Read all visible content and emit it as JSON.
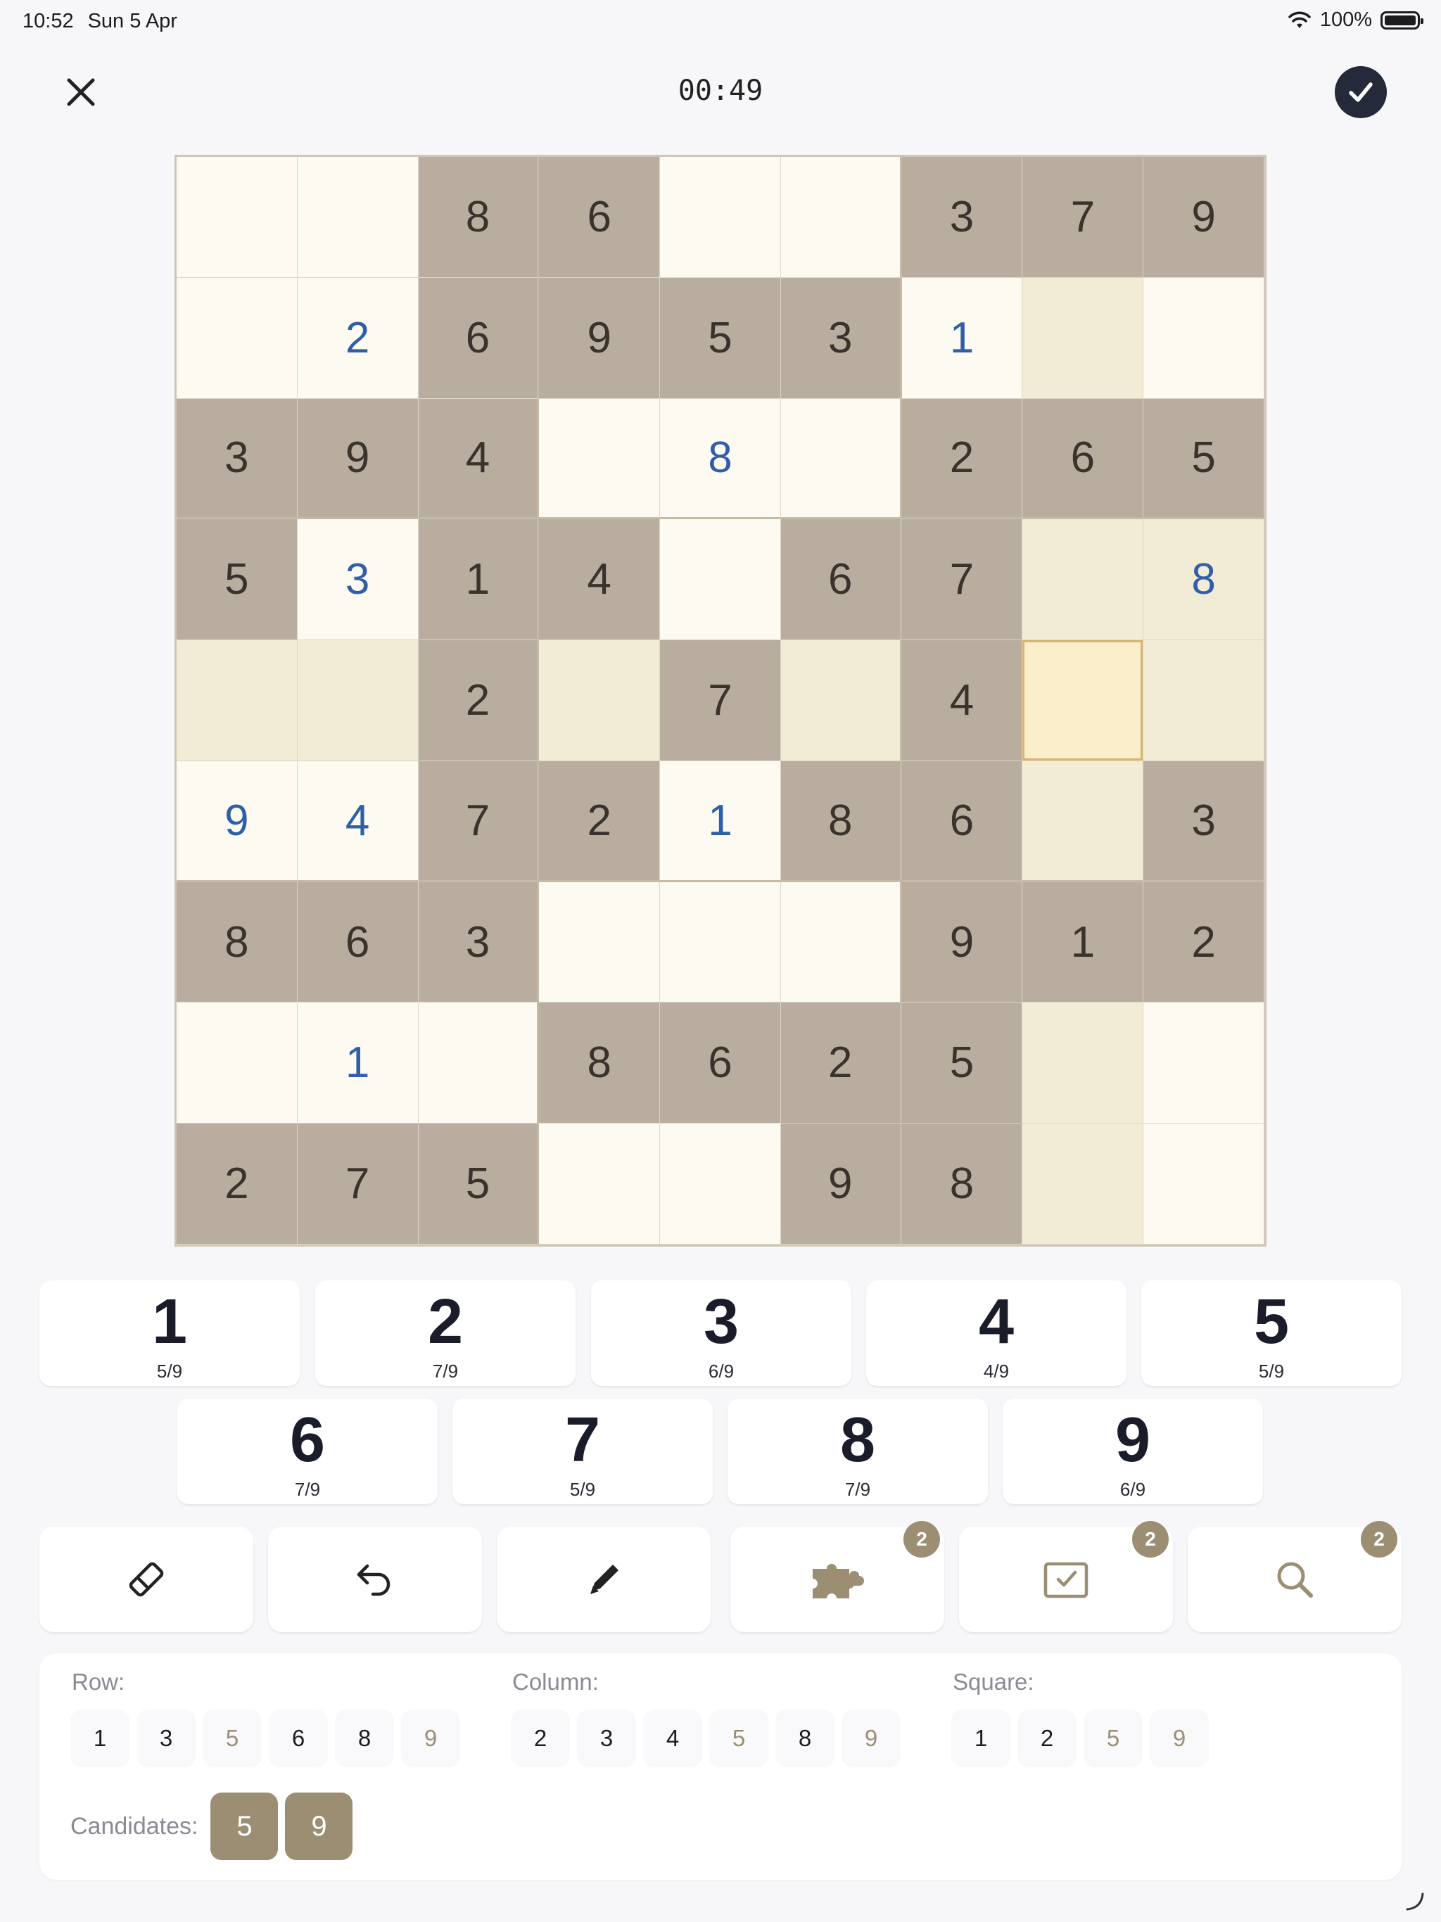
{
  "status": {
    "time": "10:52",
    "date": "Sun 5 Apr",
    "battery": "100%"
  },
  "header": {
    "timer": "00:49"
  },
  "board": {
    "selected": [
      4,
      7
    ],
    "cells": [
      [
        {
          "v": "",
          "t": "e"
        },
        {
          "v": "",
          "t": "e"
        },
        {
          "v": "8",
          "t": "g"
        },
        {
          "v": "6",
          "t": "g"
        },
        {
          "v": "",
          "t": "e"
        },
        {
          "v": "",
          "t": "e"
        },
        {
          "v": "3",
          "t": "g"
        },
        {
          "v": "7",
          "t": "g"
        },
        {
          "v": "9",
          "t": "g"
        }
      ],
      [
        {
          "v": "",
          "t": "e"
        },
        {
          "v": "2",
          "t": "u"
        },
        {
          "v": "6",
          "t": "g"
        },
        {
          "v": "9",
          "t": "g"
        },
        {
          "v": "5",
          "t": "g"
        },
        {
          "v": "3",
          "t": "g"
        },
        {
          "v": "1",
          "t": "u"
        },
        {
          "v": "",
          "t": "e"
        },
        {
          "v": "",
          "t": "e"
        }
      ],
      [
        {
          "v": "3",
          "t": "g"
        },
        {
          "v": "9",
          "t": "g"
        },
        {
          "v": "4",
          "t": "g"
        },
        {
          "v": "",
          "t": "e"
        },
        {
          "v": "8",
          "t": "u"
        },
        {
          "v": "",
          "t": "e"
        },
        {
          "v": "2",
          "t": "g"
        },
        {
          "v": "6",
          "t": "g"
        },
        {
          "v": "5",
          "t": "g"
        }
      ],
      [
        {
          "v": "5",
          "t": "g"
        },
        {
          "v": "3",
          "t": "u"
        },
        {
          "v": "1",
          "t": "g"
        },
        {
          "v": "4",
          "t": "g"
        },
        {
          "v": "",
          "t": "e"
        },
        {
          "v": "6",
          "t": "g"
        },
        {
          "v": "7",
          "t": "g"
        },
        {
          "v": "",
          "t": "e"
        },
        {
          "v": "8",
          "t": "u"
        }
      ],
      [
        {
          "v": "",
          "t": "e"
        },
        {
          "v": "",
          "t": "e"
        },
        {
          "v": "2",
          "t": "g"
        },
        {
          "v": "",
          "t": "e"
        },
        {
          "v": "7",
          "t": "g"
        },
        {
          "v": "",
          "t": "e"
        },
        {
          "v": "4",
          "t": "g"
        },
        {
          "v": "",
          "t": "e"
        },
        {
          "v": "",
          "t": "e"
        }
      ],
      [
        {
          "v": "9",
          "t": "u"
        },
        {
          "v": "4",
          "t": "u"
        },
        {
          "v": "7",
          "t": "g"
        },
        {
          "v": "2",
          "t": "g"
        },
        {
          "v": "1",
          "t": "u"
        },
        {
          "v": "8",
          "t": "g"
        },
        {
          "v": "6",
          "t": "g"
        },
        {
          "v": "",
          "t": "e"
        },
        {
          "v": "3",
          "t": "g"
        }
      ],
      [
        {
          "v": "8",
          "t": "g"
        },
        {
          "v": "6",
          "t": "g"
        },
        {
          "v": "3",
          "t": "g"
        },
        {
          "v": "",
          "t": "e"
        },
        {
          "v": "",
          "t": "e"
        },
        {
          "v": "",
          "t": "e"
        },
        {
          "v": "9",
          "t": "g"
        },
        {
          "v": "1",
          "t": "g"
        },
        {
          "v": "2",
          "t": "g"
        }
      ],
      [
        {
          "v": "",
          "t": "e"
        },
        {
          "v": "1",
          "t": "u"
        },
        {
          "v": "",
          "t": "e"
        },
        {
          "v": "8",
          "t": "g"
        },
        {
          "v": "6",
          "t": "g"
        },
        {
          "v": "2",
          "t": "g"
        },
        {
          "v": "5",
          "t": "g"
        },
        {
          "v": "",
          "t": "e"
        },
        {
          "v": "",
          "t": "e"
        }
      ],
      [
        {
          "v": "2",
          "t": "g"
        },
        {
          "v": "7",
          "t": "g"
        },
        {
          "v": "5",
          "t": "g"
        },
        {
          "v": "",
          "t": "e"
        },
        {
          "v": "",
          "t": "e"
        },
        {
          "v": "9",
          "t": "g"
        },
        {
          "v": "8",
          "t": "g"
        },
        {
          "v": "",
          "t": "e"
        },
        {
          "v": "",
          "t": "e"
        }
      ]
    ]
  },
  "keypad": [
    {
      "num": "1",
      "count": "5/9"
    },
    {
      "num": "2",
      "count": "7/9"
    },
    {
      "num": "3",
      "count": "6/9"
    },
    {
      "num": "4",
      "count": "4/9"
    },
    {
      "num": "5",
      "count": "5/9"
    },
    {
      "num": "6",
      "count": "7/9"
    },
    {
      "num": "7",
      "count": "5/9"
    },
    {
      "num": "8",
      "count": "7/9"
    },
    {
      "num": "9",
      "count": "6/9"
    }
  ],
  "tools": {
    "eraser": {
      "icon": "eraser-icon"
    },
    "undo": {
      "icon": "undo-icon"
    },
    "pencil": {
      "icon": "pencil-icon"
    },
    "hint": {
      "icon": "puzzle-icon",
      "badge": "2"
    },
    "check": {
      "icon": "checkbox-icon",
      "badge": "2"
    },
    "search": {
      "icon": "search-icon",
      "badge": "2"
    }
  },
  "analysis": {
    "row": {
      "label": "Row:",
      "values": [
        "1",
        "3",
        "5",
        "6",
        "8",
        "9"
      ]
    },
    "column": {
      "label": "Column:",
      "values": [
        "2",
        "3",
        "4",
        "5",
        "8",
        "9"
      ]
    },
    "square": {
      "label": "Square:",
      "values": [
        "1",
        "2",
        "5",
        "9"
      ]
    },
    "candidates_label": "Candidates:",
    "candidates": [
      "5",
      "9"
    ]
  },
  "colors": {
    "accent": "#9b8e72",
    "given_cell": "#b9ada0",
    "user_digit": "#2f5fa8",
    "dark": "#252a3a"
  }
}
